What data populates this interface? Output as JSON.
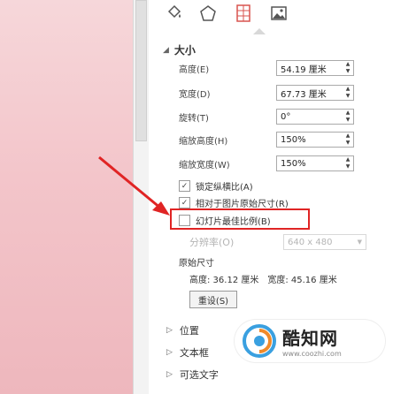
{
  "format_pane": {
    "tabs": [
      {
        "icon": "fill-line-icon"
      },
      {
        "icon": "effects-pentagon-icon"
      },
      {
        "icon": "size-properties-icon"
      },
      {
        "icon": "picture-icon"
      }
    ],
    "size_section": {
      "title": "大小",
      "height": {
        "label": "高度(E)",
        "value": "54.19 厘米"
      },
      "width": {
        "label": "宽度(D)",
        "value": "67.73 厘米"
      },
      "rotation": {
        "label": "旋转(T)",
        "value": "0°"
      },
      "scale_height": {
        "label": "缩放高度(H)",
        "value": "150%"
      },
      "scale_width": {
        "label": "缩放宽度(W)",
        "value": "150%"
      },
      "lock_aspect": {
        "label": "锁定纵横比(A)",
        "checked": true
      },
      "relative_original": {
        "label": "相对于图片原始尺寸(R)",
        "checked": true
      },
      "best_scale": {
        "label": "幻灯片最佳比例(B)",
        "checked": false
      },
      "resolution": {
        "label": "分辨率(O)",
        "value": "640 x 480"
      },
      "original_size": {
        "title": "原始尺寸",
        "height_text": "高度:  36.12 厘米",
        "width_text": "宽度:  45.16 厘米"
      },
      "reset_label": "重设(S)"
    },
    "collapsed_sections": [
      "位置",
      "文本框",
      "可选文字"
    ]
  },
  "watermark": {
    "brand": "酷知网",
    "url": "www.coozhi.com"
  },
  "colors": {
    "slide_background": "#f3c5ca",
    "highlight_red": "#e02424",
    "arrow_red": "#e02424"
  }
}
